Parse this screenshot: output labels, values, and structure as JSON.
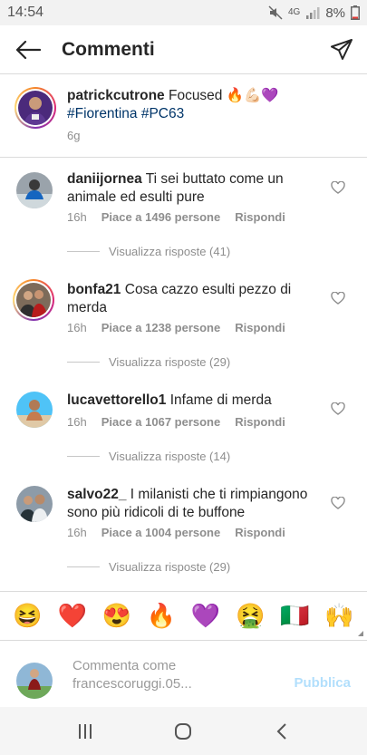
{
  "status_bar": {
    "time": "14:54",
    "network": "4G",
    "battery": "8%"
  },
  "header": {
    "title": "Commenti"
  },
  "caption": {
    "username": "patrickcutrone",
    "text": " Focused 🔥💪🏻💜",
    "hashtags": "#Fiorentina #PC63",
    "time": "6g"
  },
  "comments": [
    {
      "username": "daniijornea",
      "text": " Ti sei buttato come un animale ed esulti pure",
      "time": "16h",
      "likes": "Piace a 1496 persone",
      "reply_label": "Rispondi",
      "view_replies": "Visualizza risposte (41)"
    },
    {
      "username": "bonfa21",
      "text": " Cosa cazzo esulti pezzo di merda",
      "time": "16h",
      "likes": "Piace a 1238 persone",
      "reply_label": "Rispondi",
      "view_replies": "Visualizza risposte (29)"
    },
    {
      "username": "lucavettorello1",
      "text": " Infame di merda",
      "time": "16h",
      "likes": "Piace a 1067 persone",
      "reply_label": "Rispondi",
      "view_replies": "Visualizza risposte (14)"
    },
    {
      "username": "salvo22_",
      "text": " I milanisti che ti rimpiangono sono più ridicoli di te buffone",
      "time": "16h",
      "likes": "Piace a 1004 persone",
      "reply_label": "Rispondi",
      "view_replies": "Visualizza risposte (29)"
    }
  ],
  "emoji_bar": [
    "😆",
    "❤️",
    "😍",
    "🔥",
    "💜",
    "🤮",
    "🇮🇹",
    "🙌"
  ],
  "compose": {
    "placeholder": "Commenta come francescoruggi.05...",
    "publish_label": "Pubblica"
  },
  "colors": {
    "link": "#003569",
    "muted": "#8e8e8e",
    "publish": "#b2dffc"
  }
}
